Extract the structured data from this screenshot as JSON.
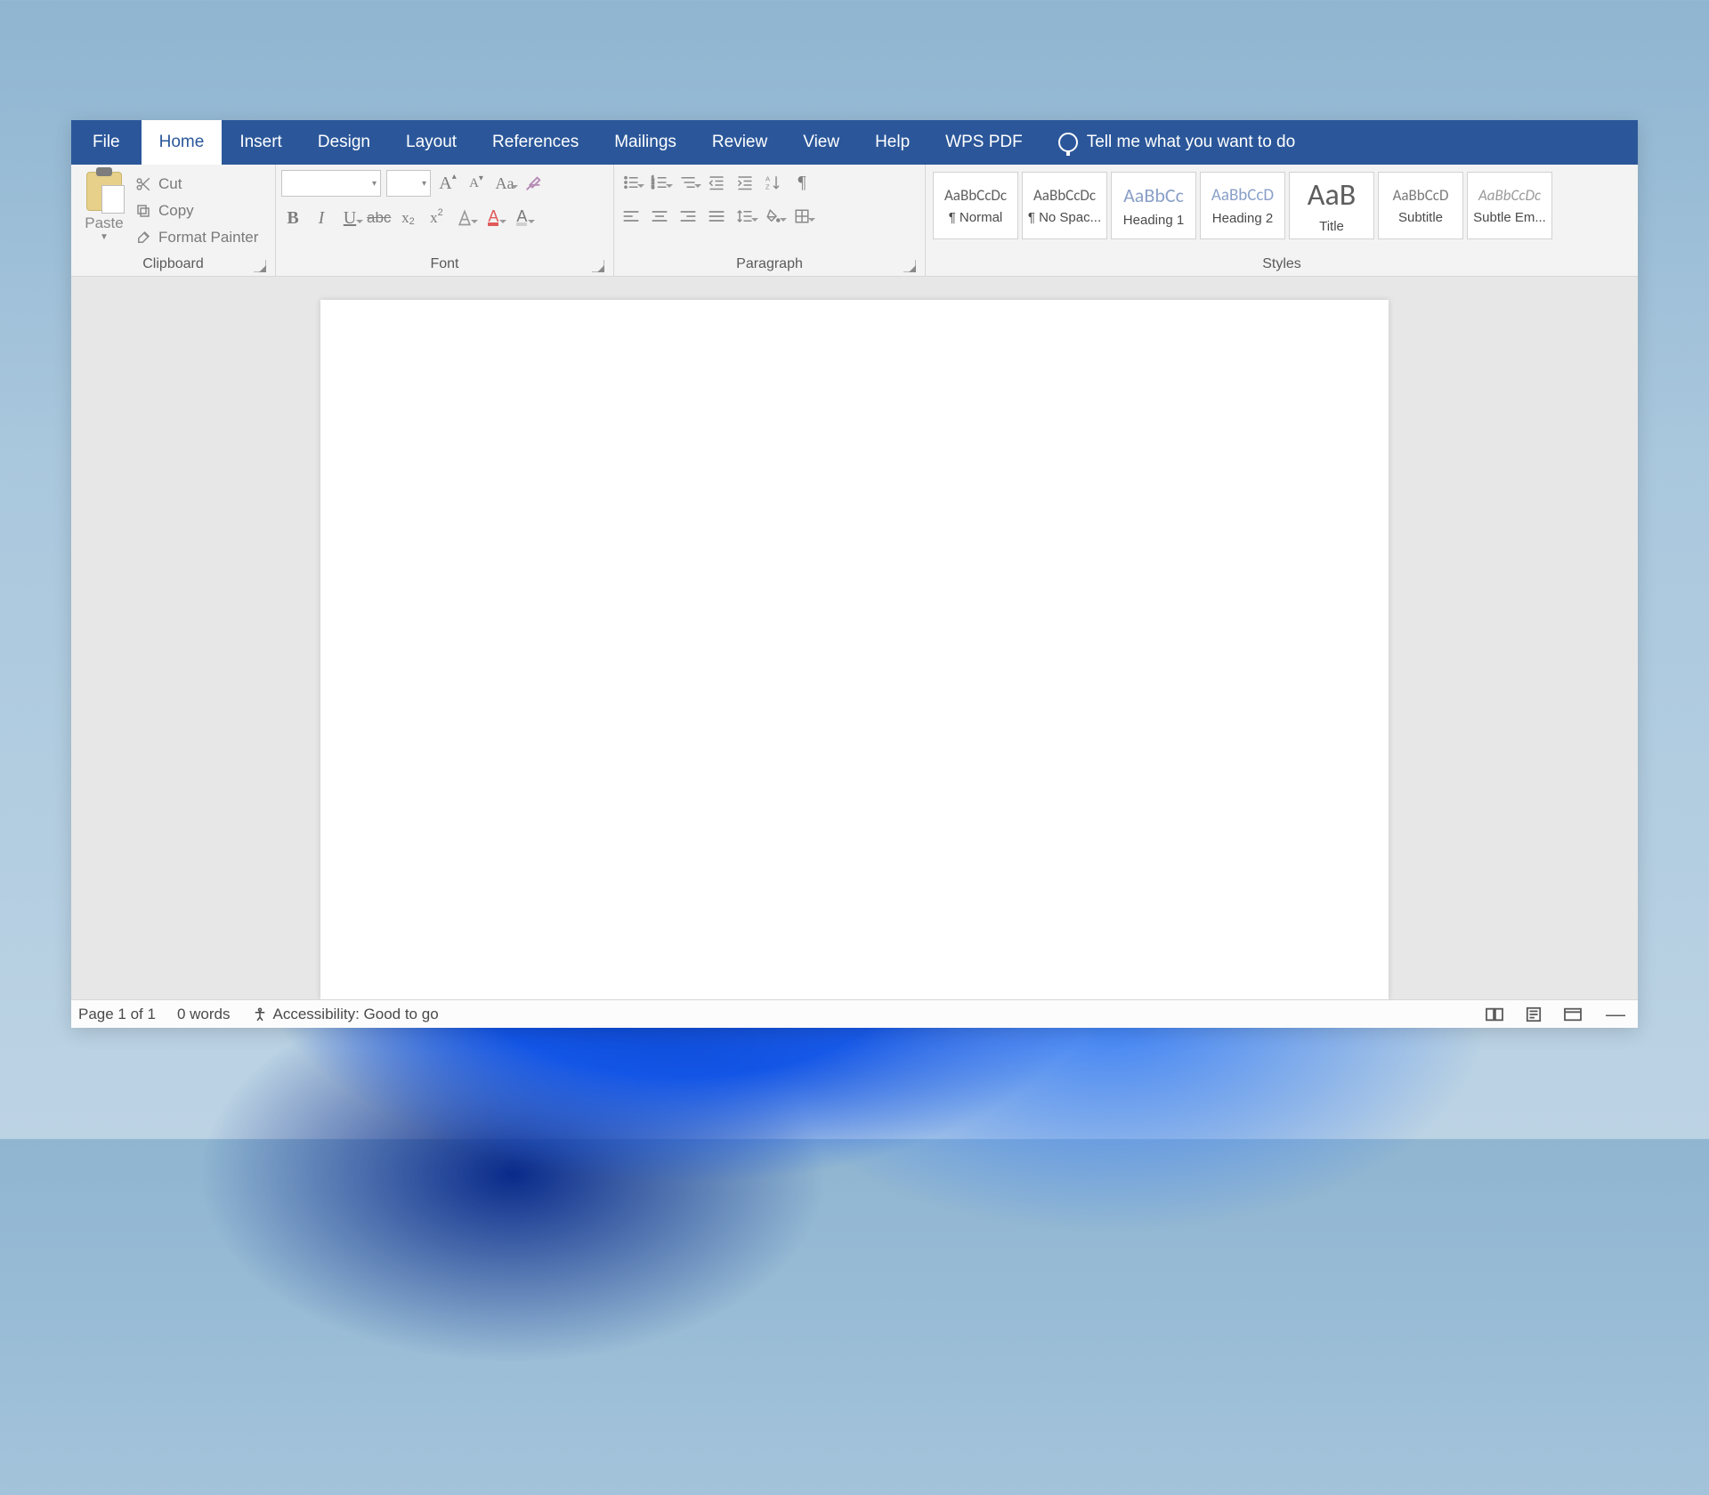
{
  "tabs": {
    "file": "File",
    "home": "Home",
    "insert": "Insert",
    "design": "Design",
    "layout": "Layout",
    "references": "References",
    "mailings": "Mailings",
    "review": "Review",
    "view": "View",
    "help": "Help",
    "wpspdf": "WPS PDF",
    "tellme": "Tell me what you want to do"
  },
  "ribbon": {
    "clipboard": {
      "label": "Clipboard",
      "paste": "Paste",
      "cut": "Cut",
      "copy": "Copy",
      "format_painter": "Format Painter"
    },
    "font": {
      "label": "Font"
    },
    "paragraph": {
      "label": "Paragraph"
    },
    "styles": {
      "label": "Styles",
      "items": [
        {
          "preview": "AaBbCcDc",
          "name": "¶ Normal",
          "size": "17px",
          "color": "#5e5e5e",
          "style": "normal"
        },
        {
          "preview": "AaBbCcDc",
          "name": "¶ No Spac...",
          "size": "17px",
          "color": "#5e5e5e",
          "style": "normal"
        },
        {
          "preview": "AaBbCc",
          "name": "Heading 1",
          "size": "22px",
          "color": "#8aa0c8",
          "style": "normal"
        },
        {
          "preview": "AaBbCcD",
          "name": "Heading 2",
          "size": "19px",
          "color": "#8aa0c8",
          "style": "normal"
        },
        {
          "preview": "AaB",
          "name": "Title",
          "size": "34px",
          "color": "#5e5e5e",
          "style": "normal"
        },
        {
          "preview": "AaBbCcD",
          "name": "Subtitle",
          "size": "17px",
          "color": "#7a7a7a",
          "style": "normal"
        },
        {
          "preview": "AaBbCcDc",
          "name": "Subtle Em...",
          "size": "17px",
          "color": "#9a9a9a",
          "style": "italic"
        }
      ]
    }
  },
  "status": {
    "page": "Page 1 of 1",
    "words": "0 words",
    "accessibility": "Accessibility: Good to go"
  }
}
